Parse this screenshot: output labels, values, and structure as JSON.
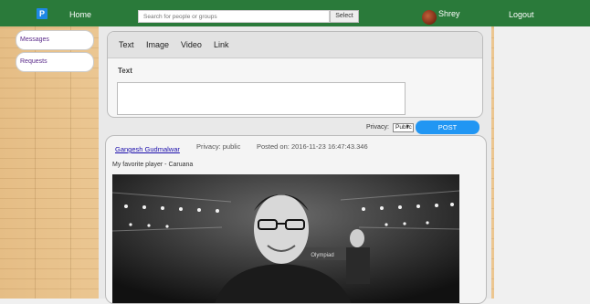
{
  "nav": {
    "logo": "P",
    "home": "Home",
    "search_placeholder": "Search for people or groups",
    "select": "Select",
    "user": "Shrey",
    "logout": "Logout"
  },
  "sidebar": {
    "items": [
      {
        "label": "Messages"
      },
      {
        "label": "Requests"
      }
    ]
  },
  "composer": {
    "tabs": [
      "Text",
      "Image",
      "Video",
      "Link"
    ],
    "section_label": "Text",
    "text_value": "",
    "privacy_label": "Privacy:",
    "privacy_value": "Public",
    "post_button": "POST"
  },
  "post": {
    "author": "Gangesh Gudmalwar",
    "privacy": "Privacy: public",
    "posted_on": "Posted on: 2016-11-23 16:47:43.346",
    "text": "My favorite player - Caruana",
    "image_scene_text": "Olympiad"
  }
}
